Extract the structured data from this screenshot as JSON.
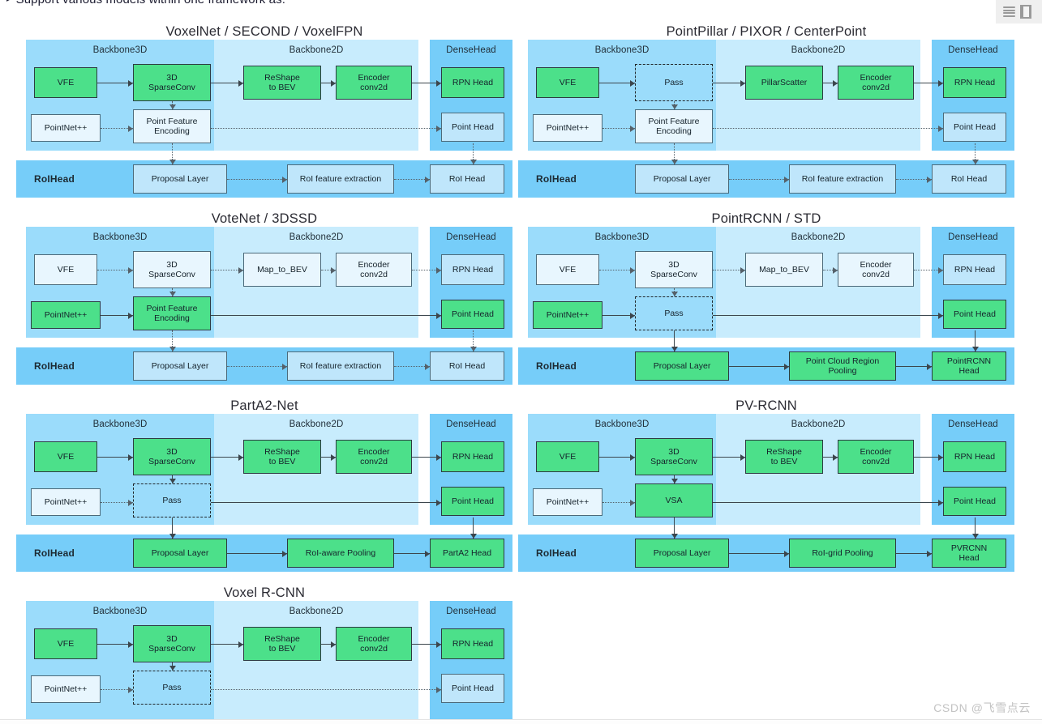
{
  "header": {
    "bullet_text": "Support various models within one framework as:",
    "bullet_glyph": "▸",
    "toolbar": {
      "list_icon": "list-view-icon",
      "panel_icon": "side-panel-icon"
    }
  },
  "watermark": "CSDN @飞雪点云",
  "palette": {
    "backbone3d_bg": "#9bdcfb",
    "backbone2d_bg": "#c8ecfd",
    "densehead_bg": "#76cdf9",
    "roihead_bg": "#76cdf9",
    "node_green": "#4ce08a",
    "node_blue": "#bfe6fb",
    "node_plain": "#e8f6fe",
    "border": "#4c6a7a",
    "connector": "#3c464d"
  },
  "pane_labels": {
    "backbone3d": "Backbone3D",
    "backbone2d": "Backbone2D",
    "densehead": "DenseHead",
    "roihead": "RoIHead"
  },
  "diagrams": [
    {
      "id": "voxelnet",
      "title": "VoxelNet / SECOND / VoxelFPN",
      "nodes": {
        "vfe": {
          "label": "VFE",
          "style": "green"
        },
        "sparseconv": {
          "label": "3D\nSparseConv",
          "style": "green"
        },
        "pointnet": {
          "label": "PointNet++",
          "style": "plain"
        },
        "pfe": {
          "label": "Point Feature\nEncoding",
          "style": "plain"
        },
        "bev": {
          "label": "ReShape\nto BEV",
          "style": "green"
        },
        "encoder": {
          "label": "Encoder\nconv2d",
          "style": "green"
        },
        "rpn": {
          "label": "RPN Head",
          "style": "green"
        },
        "pointhead": {
          "label": "Point Head",
          "style": "blue"
        },
        "proposal": {
          "label": "Proposal Layer",
          "style": "blue"
        },
        "roifeat": {
          "label": "RoI feature extraction",
          "style": "blue"
        },
        "roihead": {
          "label": "RoI Head",
          "style": "blue"
        }
      }
    },
    {
      "id": "pointpillar",
      "title": "PointPillar / PIXOR / CenterPoint",
      "nodes": {
        "vfe": {
          "label": "VFE",
          "style": "green"
        },
        "sparseconv": {
          "label": "Pass",
          "style": "dash"
        },
        "pointnet": {
          "label": "PointNet++",
          "style": "plain"
        },
        "pfe": {
          "label": "Point Feature\nEncoding",
          "style": "plain"
        },
        "bev": {
          "label": "PillarScatter",
          "style": "green"
        },
        "encoder": {
          "label": "Encoder\nconv2d",
          "style": "green"
        },
        "rpn": {
          "label": "RPN Head",
          "style": "green"
        },
        "pointhead": {
          "label": "Point Head",
          "style": "blue"
        },
        "proposal": {
          "label": "Proposal Layer",
          "style": "blue"
        },
        "roifeat": {
          "label": "RoI feature extraction",
          "style": "blue"
        },
        "roihead": {
          "label": "RoI Head",
          "style": "blue"
        }
      }
    },
    {
      "id": "votenet",
      "title": "VoteNet / 3DSSD",
      "nodes": {
        "vfe": {
          "label": "VFE",
          "style": "plain"
        },
        "sparseconv": {
          "label": "3D\nSparseConv",
          "style": "plain"
        },
        "pointnet": {
          "label": "PointNet++",
          "style": "green"
        },
        "pfe": {
          "label": "Point Feature\nEncoding",
          "style": "green"
        },
        "bev": {
          "label": "Map_to_BEV",
          "style": "plain"
        },
        "encoder": {
          "label": "Encoder\nconv2d",
          "style": "plain"
        },
        "rpn": {
          "label": "RPN Head",
          "style": "blue"
        },
        "pointhead": {
          "label": "Point Head",
          "style": "green"
        },
        "proposal": {
          "label": "Proposal Layer",
          "style": "blue"
        },
        "roifeat": {
          "label": "RoI feature extraction",
          "style": "blue"
        },
        "roihead": {
          "label": "RoI Head",
          "style": "blue"
        }
      }
    },
    {
      "id": "pointrcnn",
      "title": "PointRCNN / STD",
      "nodes": {
        "vfe": {
          "label": "VFE",
          "style": "plain"
        },
        "sparseconv": {
          "label": "3D\nSparseConv",
          "style": "plain"
        },
        "pointnet": {
          "label": "PointNet++",
          "style": "green"
        },
        "pfe": {
          "label": "Pass",
          "style": "dash"
        },
        "bev": {
          "label": "Map_to_BEV",
          "style": "plain"
        },
        "encoder": {
          "label": "Encoder\nconv2d",
          "style": "plain"
        },
        "rpn": {
          "label": "RPN Head",
          "style": "blue"
        },
        "pointhead": {
          "label": "Point Head",
          "style": "green"
        },
        "proposal": {
          "label": "Proposal Layer",
          "style": "green"
        },
        "roifeat": {
          "label": "Point Cloud Region\nPooling",
          "style": "green"
        },
        "roihead": {
          "label": "PointRCNN\nHead",
          "style": "green"
        }
      }
    },
    {
      "id": "parta2",
      "title": "PartA2-Net",
      "nodes": {
        "vfe": {
          "label": "VFE",
          "style": "green"
        },
        "sparseconv": {
          "label": "3D\nSparseConv",
          "style": "green"
        },
        "pointnet": {
          "label": "PointNet++",
          "style": "plain"
        },
        "pfe": {
          "label": "Pass",
          "style": "dash"
        },
        "bev": {
          "label": "ReShape\nto BEV",
          "style": "green"
        },
        "encoder": {
          "label": "Encoder\nconv2d",
          "style": "green"
        },
        "rpn": {
          "label": "RPN Head",
          "style": "green"
        },
        "pointhead": {
          "label": "Point Head",
          "style": "green"
        },
        "proposal": {
          "label": "Proposal Layer",
          "style": "green"
        },
        "roifeat": {
          "label": "RoI-aware Pooling",
          "style": "green"
        },
        "roihead": {
          "label": "PartA2 Head",
          "style": "green"
        }
      }
    },
    {
      "id": "pvrcnn",
      "title": "PV-RCNN",
      "nodes": {
        "vfe": {
          "label": "VFE",
          "style": "green"
        },
        "sparseconv": {
          "label": "3D\nSparseConv",
          "style": "green"
        },
        "pointnet": {
          "label": "PointNet++",
          "style": "plain"
        },
        "pfe": {
          "label": "VSA",
          "style": "green"
        },
        "bev": {
          "label": "ReShape\nto BEV",
          "style": "green"
        },
        "encoder": {
          "label": "Encoder\nconv2d",
          "style": "green"
        },
        "rpn": {
          "label": "RPN Head",
          "style": "green"
        },
        "pointhead": {
          "label": "Point Head",
          "style": "green"
        },
        "proposal": {
          "label": "Proposal Layer",
          "style": "green"
        },
        "roifeat": {
          "label": "RoI-grid Pooling",
          "style": "green"
        },
        "roihead": {
          "label": "PVRCNN\nHead",
          "style": "green"
        }
      }
    },
    {
      "id": "voxelrcnn",
      "title": "Voxel R-CNN",
      "nodes": {
        "vfe": {
          "label": "VFE",
          "style": "green"
        },
        "sparseconv": {
          "label": "3D\nSparseConv",
          "style": "green"
        },
        "pointnet": {
          "label": "PointNet++",
          "style": "plain"
        },
        "pfe": {
          "label": "Pass",
          "style": "dash"
        },
        "bev": {
          "label": "ReShape\nto BEV",
          "style": "green"
        },
        "encoder": {
          "label": "Encoder\nconv2d",
          "style": "green"
        },
        "rpn": {
          "label": "RPN Head",
          "style": "green"
        },
        "pointhead": {
          "label": "Point Head",
          "style": "blue"
        }
      }
    }
  ]
}
